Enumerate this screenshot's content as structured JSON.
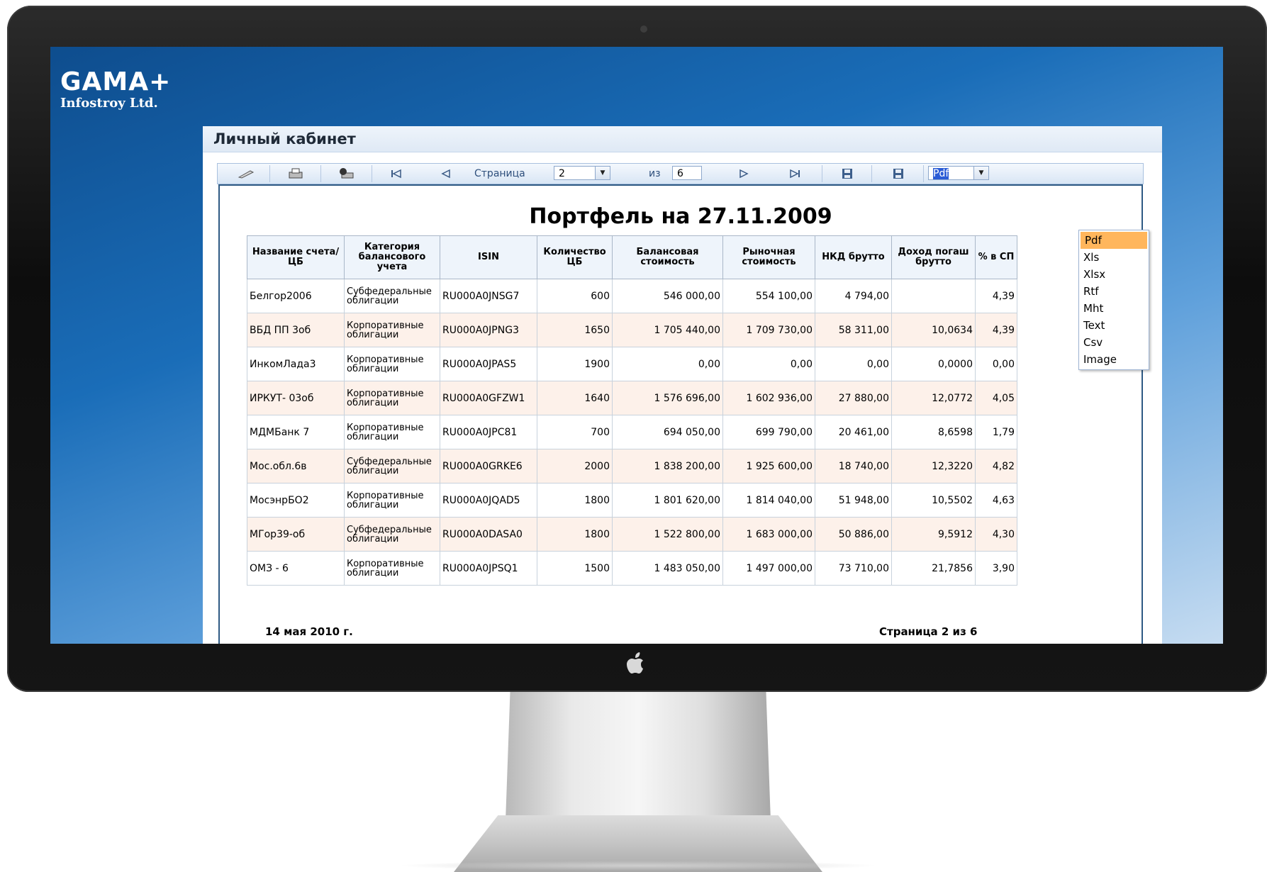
{
  "brand": {
    "title": "GAMA+",
    "subtitle": "Infostroy Ltd."
  },
  "panel": {
    "title": "Личный кабинет"
  },
  "toolbar": {
    "page_label": "Страница",
    "page_value": "2",
    "of_label": "из",
    "total_pages": "6",
    "format_value": "Pdf",
    "icons": [
      "edit-icon",
      "print-icon",
      "print-setup-icon",
      "first-page-icon",
      "prev-page-icon",
      "next-page-icon",
      "last-page-icon",
      "save-icon",
      "export-icon"
    ]
  },
  "format_options": [
    "Pdf",
    "Xls",
    "Xlsx",
    "Rtf",
    "Mht",
    "Text",
    "Csv",
    "Image"
  ],
  "report": {
    "title": "Портфель на 27.11.2009",
    "columns": [
      "Название счета/ЦБ",
      "Категория балансового учета",
      "ISIN",
      "Количество ЦБ",
      "Балансовая стоимость",
      "Рыночная стоимость",
      "НКД брутто",
      "Доход погаш брутто",
      "% в СП"
    ],
    "rows": [
      [
        "Белгор2006",
        "Субфедеральные облигации",
        "RU000A0JNSG7",
        "600",
        "546 000,00",
        "554 100,00",
        "4 794,00",
        "",
        "4,39"
      ],
      [
        "ВБД ПП 3об",
        "Корпоративные облигации",
        "RU000A0JPNG3",
        "1650",
        "1 705 440,00",
        "1 709 730,00",
        "58 311,00",
        "10,0634",
        "4,39"
      ],
      [
        "ИнкомЛада3",
        "Корпоративные облигации",
        "RU000A0JPAS5",
        "1900",
        "0,00",
        "0,00",
        "0,00",
        "0,0000",
        "0,00"
      ],
      [
        "ИРКУТ- 03об",
        "Корпоративные облигации",
        "RU000A0GFZW1",
        "1640",
        "1 576 696,00",
        "1 602 936,00",
        "27 880,00",
        "12,0772",
        "4,05"
      ],
      [
        "МДМБанк 7",
        "Корпоративные облигации",
        "RU000A0JPC81",
        "700",
        "694 050,00",
        "699 790,00",
        "20 461,00",
        "8,6598",
        "1,79"
      ],
      [
        "Мос.обл.6в",
        "Субфедеральные облигации",
        "RU000A0GRKE6",
        "2000",
        "1 838 200,00",
        "1 925 600,00",
        "18 740,00",
        "12,3220",
        "4,82"
      ],
      [
        "МосэнрБО2",
        "Корпоративные облигации",
        "RU000A0JQAD5",
        "1800",
        "1 801 620,00",
        "1 814 040,00",
        "51 948,00",
        "10,5502",
        "4,63"
      ],
      [
        "МГор39-об",
        "Субфедеральные облигации",
        "RU000A0DASA0",
        "1800",
        "1 522 800,00",
        "1 683 000,00",
        "50 886,00",
        "9,5912",
        "4,30"
      ],
      [
        "ОМЗ - 6",
        "Корпоративные облигации",
        "RU000A0JPSQ1",
        "1500",
        "1 483 050,00",
        "1 497 000,00",
        "73 710,00",
        "21,7856",
        "3,90"
      ]
    ],
    "footer_date": "14 мая 2010 г.",
    "footer_page": "Страница 2 из 6"
  }
}
